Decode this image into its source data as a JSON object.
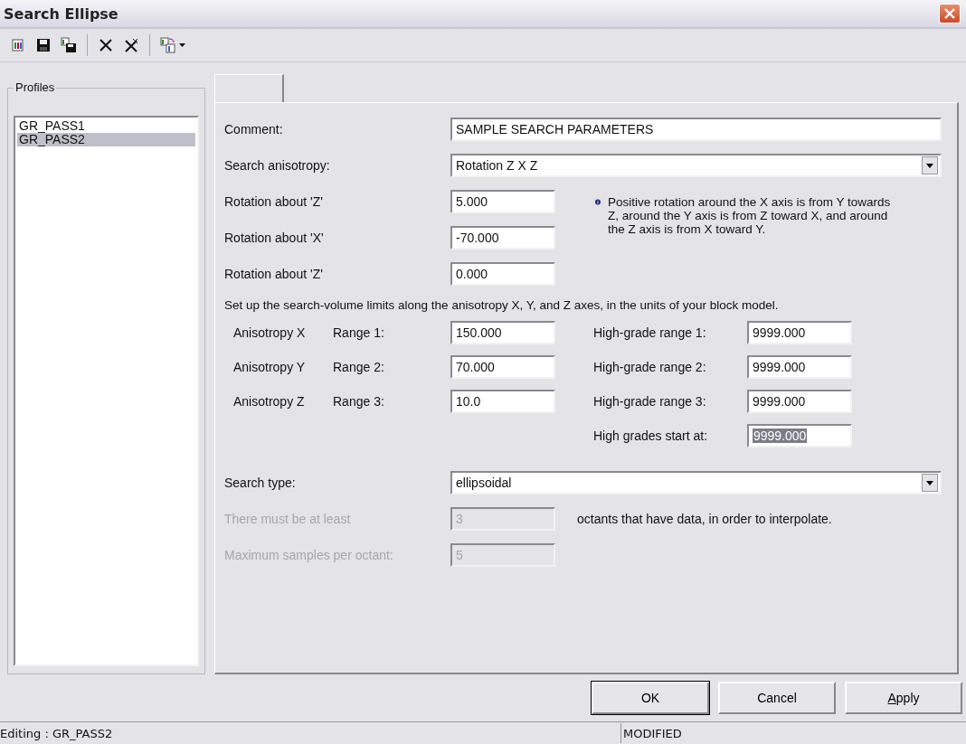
{
  "window": {
    "title": "Search Ellipse"
  },
  "toolbar": {
    "buttons": [
      {
        "kind": "new"
      },
      {
        "kind": "save"
      },
      {
        "kind": "saveas"
      },
      {
        "kind": "sep"
      },
      {
        "kind": "delete"
      },
      {
        "kind": "deleteall"
      },
      {
        "kind": "sep"
      },
      {
        "kind": "copy",
        "dropdown": true
      }
    ]
  },
  "profiles": {
    "title": "Profiles",
    "items": [
      {
        "label": "GR_PASS1",
        "selected": false
      },
      {
        "label": "GR_PASS2",
        "selected": true
      }
    ]
  },
  "panel": {
    "comment": {
      "label": "Comment:",
      "value": "SAMPLE SEARCH PARAMETERS"
    },
    "anisotropy": {
      "label": "Search anisotropy:",
      "value": "Rotation Z X Z"
    },
    "rotations": [
      {
        "label": "Rotation about 'Z'",
        "value": "5.000"
      },
      {
        "label": "Rotation about 'X'",
        "value": "-70.000"
      },
      {
        "label": "Rotation about 'Z'",
        "value": "0.000"
      }
    ],
    "info": "Positive rotation around the X axis is from Y towards Z, around the Y axis is from Z toward X, and around the Z axis is from X toward Y.",
    "limits_note": "Set up the search-volume limits along the anisotropy X, Y, and Z axes, in the units of your block model.",
    "ranges": [
      {
        "axis": "Anisotropy X",
        "range_label": "Range 1:",
        "value": "150.000",
        "high_label": "High-grade range 1:",
        "high_value": "9999.000"
      },
      {
        "axis": "Anisotropy Y",
        "range_label": "Range 2:",
        "value": "70.000",
        "high_label": "High-grade range 2:",
        "high_value": "9999.000"
      },
      {
        "axis": "Anisotropy Z",
        "range_label": "Range 3:",
        "value": "10.0",
        "high_label": "High-grade range 3:",
        "high_value": "9999.000"
      }
    ],
    "high_start": {
      "label": "High grades start at:",
      "value": "9999.000",
      "selected": true
    },
    "search_type": {
      "label": "Search type:",
      "value": "ellipsoidal"
    },
    "octants": {
      "label": "There must be at least",
      "value": "3",
      "suffix": "octants that have data, in order to interpolate.",
      "disabled": true
    },
    "max_samples": {
      "label": "Maximum samples per octant:",
      "value": "5",
      "disabled": true
    }
  },
  "buttons": [
    {
      "label": "OK",
      "default": true
    },
    {
      "label": "Cancel",
      "default": false
    },
    {
      "label": "Apply",
      "default": false,
      "mnemonic_first": true
    }
  ],
  "status_bar": [
    "Editing : GR_PASS2",
    "MODIFIED"
  ]
}
